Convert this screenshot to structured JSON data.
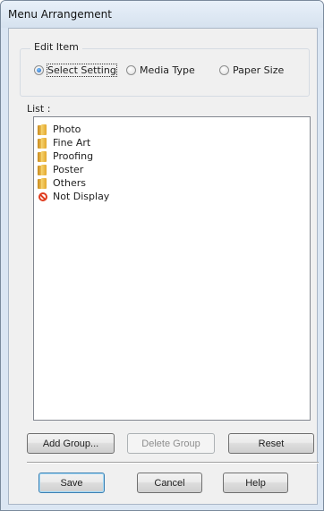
{
  "window": {
    "title": "Menu Arrangement"
  },
  "edit_item": {
    "label": "Edit Item",
    "options": [
      {
        "label": "Select Setting",
        "checked": true
      },
      {
        "label": "Media Type",
        "checked": false
      },
      {
        "label": "Paper Size",
        "checked": false
      }
    ]
  },
  "list": {
    "label": "List :",
    "items": [
      {
        "label": "Photo",
        "icon": "folder-icon"
      },
      {
        "label": "Fine Art",
        "icon": "folder-icon"
      },
      {
        "label": "Proofing",
        "icon": "folder-icon"
      },
      {
        "label": "Poster",
        "icon": "folder-icon"
      },
      {
        "label": "Others",
        "icon": "folder-icon"
      },
      {
        "label": "Not Display",
        "icon": "no-display-icon"
      }
    ]
  },
  "group_buttons": {
    "add": "Add Group...",
    "delete": "Delete Group",
    "reset": "Reset"
  },
  "footer_buttons": {
    "save": "Save",
    "cancel": "Cancel",
    "help": "Help"
  },
  "colors": {
    "title_bar": "#dbe6f3",
    "dialog_background": "#f0f0f0",
    "folder": "#f2c04e",
    "no_display": "#e03c1f"
  }
}
